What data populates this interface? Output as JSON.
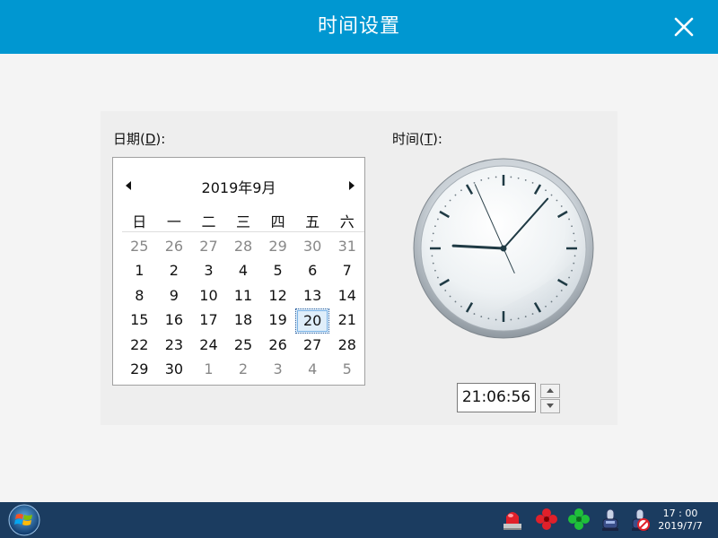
{
  "window": {
    "title": "时间设置",
    "close_icon": "close-icon",
    "accent_color": "#0097d1"
  },
  "date_label": {
    "text": "日期(",
    "mnemonic": "D",
    "suffix": "):"
  },
  "time_label": {
    "text": "时间(",
    "mnemonic": "T",
    "suffix": "):"
  },
  "calendar": {
    "month_title": "2019年9月",
    "weekdays": [
      "日",
      "一",
      "二",
      "三",
      "四",
      "五",
      "六"
    ],
    "weeks": [
      [
        {
          "d": "25",
          "o": true
        },
        {
          "d": "26",
          "o": true
        },
        {
          "d": "27",
          "o": true
        },
        {
          "d": "28",
          "o": true
        },
        {
          "d": "29",
          "o": true
        },
        {
          "d": "30",
          "o": true
        },
        {
          "d": "31",
          "o": true
        }
      ],
      [
        {
          "d": "1"
        },
        {
          "d": "2"
        },
        {
          "d": "3"
        },
        {
          "d": "4"
        },
        {
          "d": "5"
        },
        {
          "d": "6"
        },
        {
          "d": "7"
        }
      ],
      [
        {
          "d": "8"
        },
        {
          "d": "9"
        },
        {
          "d": "10"
        },
        {
          "d": "11"
        },
        {
          "d": "12"
        },
        {
          "d": "13"
        },
        {
          "d": "14"
        }
      ],
      [
        {
          "d": "15"
        },
        {
          "d": "16"
        },
        {
          "d": "17"
        },
        {
          "d": "18"
        },
        {
          "d": "19"
        },
        {
          "d": "20",
          "sel": true
        },
        {
          "d": "21"
        }
      ],
      [
        {
          "d": "22"
        },
        {
          "d": "23"
        },
        {
          "d": "24"
        },
        {
          "d": "25"
        },
        {
          "d": "26"
        },
        {
          "d": "27"
        },
        {
          "d": "28"
        }
      ],
      [
        {
          "d": "29"
        },
        {
          "d": "30"
        },
        {
          "d": "1",
          "o": true
        },
        {
          "d": "2",
          "o": true
        },
        {
          "d": "3",
          "o": true
        },
        {
          "d": "4",
          "o": true
        },
        {
          "d": "5",
          "o": true
        }
      ]
    ]
  },
  "clock": {
    "hours": 21,
    "minutes": 6,
    "seconds": 56
  },
  "time_input": {
    "value": "21:06:56"
  },
  "taskbar": {
    "start_icon": "windows-start-icon",
    "tray_icons": [
      "alarm-light-icon",
      "red-fan-icon",
      "green-fan-icon",
      "robot-icon",
      "robot-disabled-icon"
    ],
    "clock_time": "17 : 00",
    "clock_date": "2019/7/7"
  }
}
